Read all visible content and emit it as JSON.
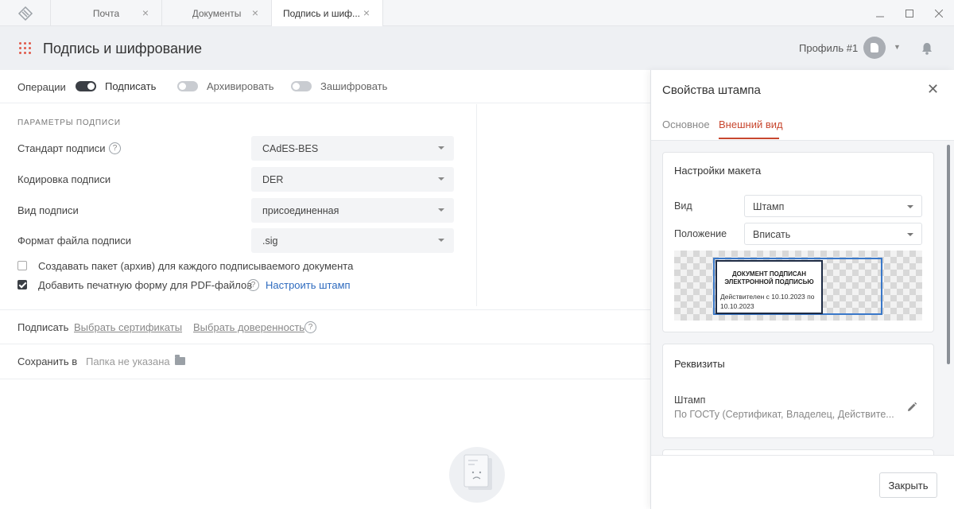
{
  "tabs": [
    {
      "label": "Почта",
      "active": false
    },
    {
      "label": "Документы",
      "active": false
    },
    {
      "label": "Подпись и шиф...",
      "active": true
    }
  ],
  "header": {
    "title": "Подпись и шифрование",
    "profile": "Профиль #1"
  },
  "operations": {
    "label": "Операции",
    "sign": "Подписать",
    "archive": "Архивировать",
    "encrypt": "Зашифровать"
  },
  "params": {
    "section_title": "ПАРАМЕТРЫ ПОДПИСИ",
    "help_glyph": "?",
    "rows": [
      {
        "label": "Стандарт подписи",
        "value": "CAdES-BES"
      },
      {
        "label": "Кодировка подписи",
        "value": "DER"
      },
      {
        "label": "Вид подписи",
        "value": "присоединенная"
      },
      {
        "label": "Формат файла подписи",
        "value": ".sig"
      }
    ],
    "checkbox_package": "Создавать пакет (архив) для каждого подписываемого документа",
    "checkbox_pdf": "Добавить печатную форму для PDF-файлов",
    "configure_stamp": "Настроить штамп"
  },
  "sign_row": {
    "label": "Подписать",
    "choose_certificates": "Выбрать сертификаты",
    "choose_poa": "Выбрать доверенность"
  },
  "save_row": {
    "label": "Сохранить в",
    "folder": "Папка не указана"
  },
  "panel": {
    "title": "Свойства штампа",
    "close_glyph": "✕",
    "tab_basic": "Основное",
    "tab_appearance": "Внешний вид",
    "layout_card": {
      "title": "Настройки макета",
      "view_label": "Вид",
      "view_value": "Штамп",
      "position_label": "Положение",
      "position_value": "Вписать"
    },
    "stamp_preview": {
      "line1": "ДОКУМЕНТ ПОДПИСАН",
      "line2": "ЭЛЕКТРОННОЙ ПОДПИСЬЮ",
      "valid": "Действителен с 10.10.2023 по 10.10.2023"
    },
    "requisites_card": {
      "title": "Реквизиты",
      "item_name": "Штамп",
      "item_value": "По ГОСТу (Сертификат, Владелец, Действите..."
    },
    "close_button": "Закрыть"
  },
  "colors": {
    "accent": "#c8472f",
    "link": "#2e6bbf",
    "toggle_on": "#3b3f45"
  }
}
